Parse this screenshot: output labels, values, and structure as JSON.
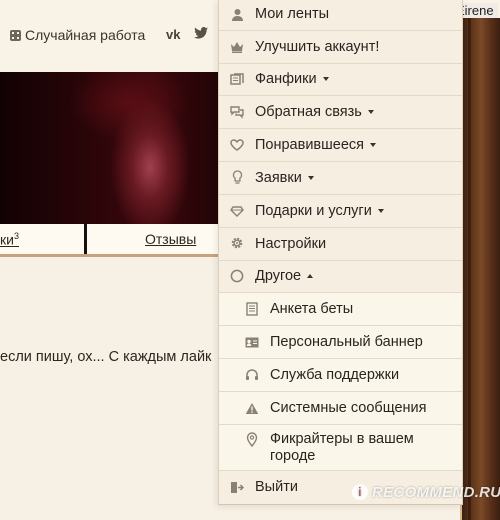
{
  "header": {
    "random_work": "Случайная работа",
    "social": [
      "vk-icon",
      "twitter-icon"
    ],
    "user_name": "Eirene"
  },
  "tabs": {
    "left_partial": "ки",
    "left_sup": "3",
    "reviews": "Отзывы"
  },
  "content": {
    "snippet": "если пишу, ох... С каждым лайк"
  },
  "menu": {
    "items": [
      {
        "label": "Мои ленты",
        "icon": "person-icon"
      },
      {
        "label": "Улучшить аккаунт!",
        "icon": "crown-icon"
      },
      {
        "label": "Фанфики",
        "icon": "books-icon",
        "dropdown": true
      },
      {
        "label": "Обратная связь",
        "icon": "chat-icon",
        "dropdown": true
      },
      {
        "label": "Понравившееся",
        "icon": "heart-icon",
        "dropdown": true
      },
      {
        "label": "Заявки",
        "icon": "lightbulb-icon",
        "dropdown": true
      },
      {
        "label": "Подарки и услуги",
        "icon": "diamond-icon",
        "dropdown": true
      },
      {
        "label": "Настройки",
        "icon": "gear-icon"
      },
      {
        "label": "Другое",
        "icon": "circle-icon",
        "expanded": true
      }
    ],
    "sub_items": [
      {
        "label": "Анкета беты",
        "icon": "document-icon"
      },
      {
        "label": "Персональный баннер",
        "icon": "id-card-icon"
      },
      {
        "label": "Служба поддержки",
        "icon": "headset-icon"
      },
      {
        "label": "Системные сообщения",
        "icon": "warning-icon"
      },
      {
        "label": "Фикрайтеры в вашем городе",
        "icon": "map-pin-icon"
      }
    ],
    "logout": {
      "label": "Выйти",
      "icon": "logout-icon"
    }
  },
  "watermark": "RECOMMEND.RU",
  "colors": {
    "menu_bg": "#f6efe1",
    "submenu_bg": "#fbf6ea",
    "icon": "#8a8176",
    "accent_border": "#c8a27b"
  }
}
